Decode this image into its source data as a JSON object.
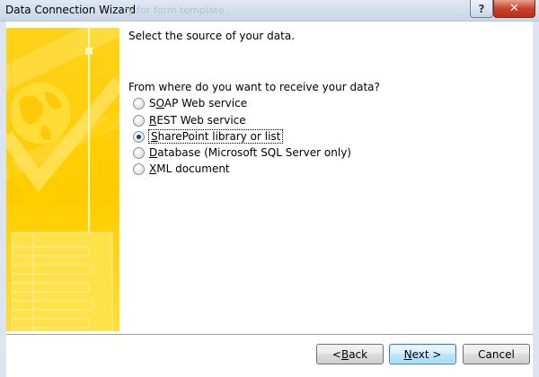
{
  "window": {
    "title": "Data Connection Wizard",
    "ghost_title": "ty for form template",
    "help_glyph": "?",
    "close_glyph": "✕"
  },
  "main": {
    "heading": "Select the source of your data.",
    "question": "From where do you want to receive your data?",
    "options": [
      {
        "pre": "S",
        "key": "O",
        "rest": "AP Web service",
        "checked": false
      },
      {
        "pre": "",
        "key": "R",
        "rest": "EST Web service",
        "checked": false
      },
      {
        "pre": "",
        "key": "S",
        "rest": "harePoint library or list",
        "checked": true
      },
      {
        "pre": "",
        "key": "D",
        "rest": "atabase (Microsoft SQL Server only)",
        "checked": false
      },
      {
        "pre": "",
        "key": "X",
        "rest": "ML document",
        "checked": false
      }
    ]
  },
  "buttons": {
    "back": {
      "pre": "< ",
      "key": "B",
      "rest": "ack"
    },
    "next": {
      "pre": "",
      "key": "N",
      "rest": "ext >"
    },
    "cancel": "Cancel"
  },
  "colors": {
    "banner_yellow": "#ffcc00",
    "close_red": "#c7432b",
    "default_button_border": "#3c7fb1"
  },
  "icons": [
    "help-icon",
    "close-icon",
    "globe-checkmark-art"
  ]
}
